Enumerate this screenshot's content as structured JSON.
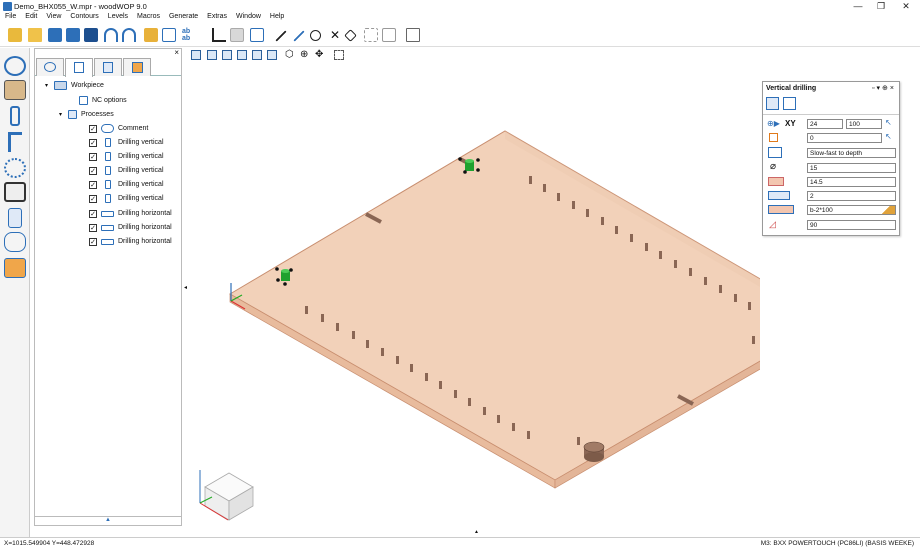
{
  "window": {
    "title": "Demo_BHX055_W.mpr - woodWOP 9.0",
    "controls": [
      "—",
      "❐",
      "✕"
    ]
  },
  "menu": [
    "File",
    "Edit",
    "View",
    "Contours",
    "Levels",
    "Macros",
    "Generate",
    "Extras",
    "Window",
    "Help"
  ],
  "tree": {
    "workpiece": "Workpiece",
    "nc_options": "NC options",
    "processes": "Processes",
    "items": [
      "Comment",
      "Drilling vertical",
      "Drilling vertical",
      "Drilling vertical",
      "Drilling vertical",
      "Drilling vertical",
      "Drilling horizontal",
      "Drilling horizontal",
      "Drilling horizontal"
    ]
  },
  "vertical_drilling": {
    "title": "Vertical drilling",
    "xy_label": "XY",
    "x_value": "24",
    "y_value": "100",
    "ref_value": "0",
    "mode_value": "Slow-fast to depth",
    "diameter_value": "15",
    "depth_value": "14.5",
    "count_value": "2",
    "distance_value": "b-2*100",
    "angle_value": "90"
  },
  "status": {
    "coords": "X=1015.549904 Y=448.472928",
    "machine": "M3: BXX POWERTOUCH (PC86LI) (BASIS WEEKE)"
  },
  "colors": {
    "board_top": "#f2d1b9",
    "board_edge": "#e3b598",
    "drill_green": "#1fa12f",
    "accent_blue": "#2d6fb8"
  },
  "icons": [
    "new-file-icon",
    "open-icon",
    "save-icon",
    "undo-icon",
    "redo-icon",
    "workpiece-icon",
    "contour-icon",
    "drill-icon",
    "saw-icon",
    "settings-icon"
  ]
}
